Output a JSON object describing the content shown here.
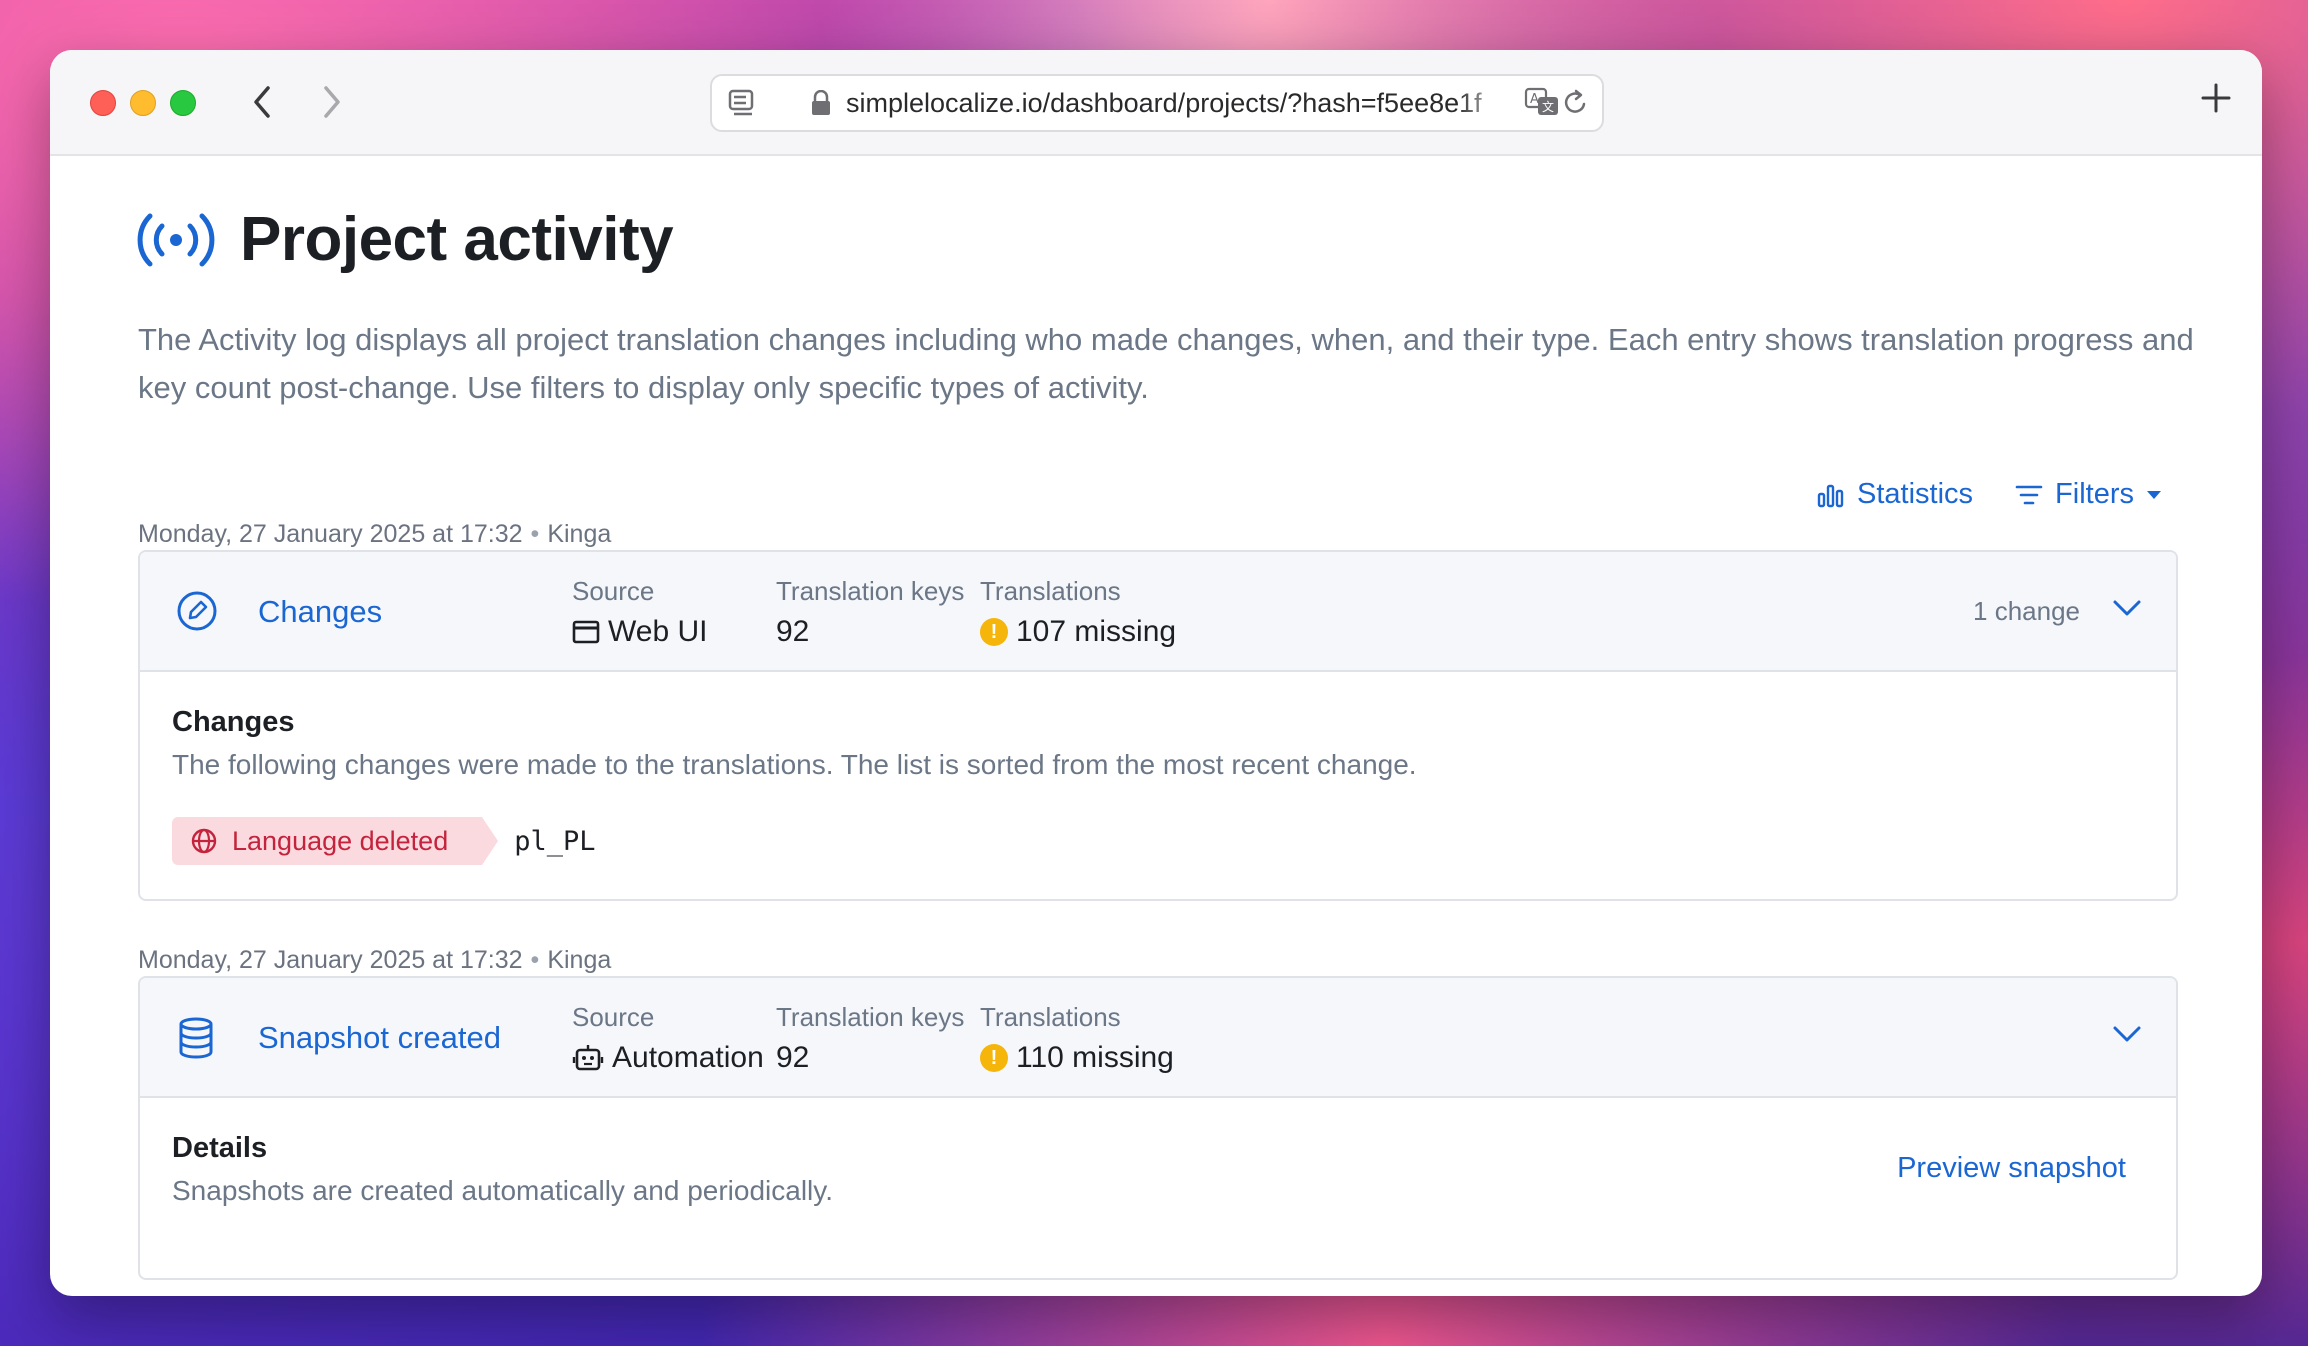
{
  "browser": {
    "url": "simplelocalize.io/dashboard/projects/?hash=f5ee8e1f"
  },
  "page": {
    "title": "Project activity",
    "description": "The Activity log displays all project translation changes including who made changes, when, and their type. Each entry shows translation progress and key count post-change. Use filters to display only specific types of activity."
  },
  "actions": {
    "statistics_label": "Statistics",
    "filters_label": "Filters"
  },
  "entries": [
    {
      "date": "Monday, 27 January 2025 at 17:32",
      "user": "Kinga",
      "title": "Changes",
      "icon": "edit-circle-icon",
      "source_label": "Source",
      "source_value": "Web UI",
      "source_icon": "browser-window-icon",
      "keys_label": "Translation keys",
      "keys_value": "92",
      "translations_label": "Translations",
      "translations_value": "107 missing",
      "change_count": "1 change",
      "body": {
        "title": "Changes",
        "description": "The following changes were made to the translations. The list is sorted from the most recent change.",
        "change_tag": "Language deleted",
        "change_value": "pl_PL"
      }
    },
    {
      "date": "Monday, 27 January 2025 at 17:32",
      "user": "Kinga",
      "title": "Snapshot created",
      "icon": "database-icon",
      "source_label": "Source",
      "source_value": "Automation",
      "source_icon": "robot-icon",
      "keys_label": "Translation keys",
      "keys_value": "92",
      "translations_label": "Translations",
      "translations_value": "110 missing",
      "body": {
        "title": "Details",
        "description": "Snapshots are created automatically and periodically.",
        "link_label": "Preview snapshot"
      }
    }
  ],
  "colors": {
    "accent": "#1a66d2",
    "warning": "#f5b50a",
    "danger_bg": "#fbdadf",
    "danger_text": "#c4233d"
  }
}
